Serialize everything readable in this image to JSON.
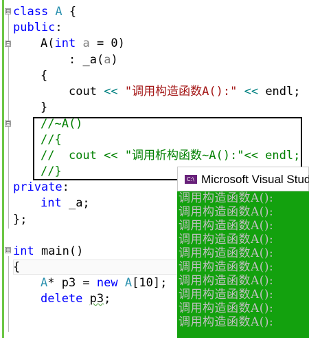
{
  "editor": {
    "lines": {
      "l1": [
        "class ",
        "A",
        " {"
      ],
      "l2": [
        "public",
        ":"
      ],
      "l3": [
        "A(",
        "int",
        " ",
        "a",
        " = 0)"
      ],
      "l4": [
        ": _a(",
        "a",
        ")"
      ],
      "l5": [
        "{"
      ],
      "l6": [
        "cout ",
        "<<",
        " ",
        "\"调用构造函数A():\"",
        " ",
        "<<",
        " endl;"
      ],
      "l7": [
        "}"
      ],
      "l8": [
        "//~A()"
      ],
      "l9": [
        "//{"
      ],
      "l10": [
        "//  cout << \"调用析构函数~A():\"<< endl;"
      ],
      "l11": [
        "//}"
      ],
      "l12": [
        "private",
        ":"
      ],
      "l13": [
        "int",
        " _a;"
      ],
      "l14": [
        "};"
      ],
      "l15": [
        "int",
        " main()"
      ],
      "l16": [
        "{"
      ],
      "l17": [
        "A",
        "* p3 = ",
        "new",
        " ",
        "A",
        "[10];"
      ],
      "l18": [
        "delete",
        " ",
        "p3",
        ";"
      ]
    },
    "fold_glyph": "⊟"
  },
  "console": {
    "icon_label": "C:\\",
    "title": "Microsoft Visual Studio",
    "output_lines": [
      "调用构造函数A():",
      "调用构造函数A():",
      "调用构造函数A():",
      "调用构造函数A():",
      "调用构造函数A():",
      "调用构造函数A():",
      "调用构造函数A():",
      "调用构造函数A():",
      "调用构造函数A():",
      "调用构造函数A():"
    ]
  },
  "colors": {
    "keyword": "#0000ff",
    "type": "#2b91af",
    "string": "#a31515",
    "comment": "#008000",
    "console_bg": "#13a10e",
    "console_fg": "#c0c0c0"
  }
}
